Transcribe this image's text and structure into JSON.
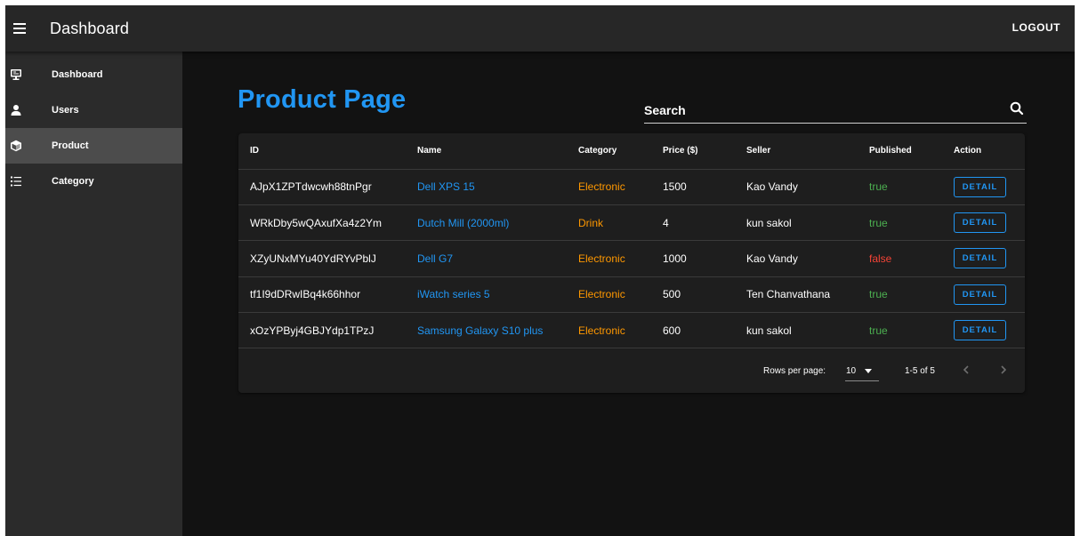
{
  "appbar": {
    "title": "Dashboard",
    "logout_label": "LOGOUT"
  },
  "sidebar": {
    "items": [
      {
        "label": "Dashboard",
        "icon": "monitor-icon"
      },
      {
        "label": "Users",
        "icon": "user-icon"
      },
      {
        "label": "Product",
        "icon": "cube-icon",
        "active": true
      },
      {
        "label": "Category",
        "icon": "list-icon"
      }
    ]
  },
  "main": {
    "title": "Product Page",
    "search": {
      "placeholder": "Search",
      "value": ""
    }
  },
  "table": {
    "headers": [
      "ID",
      "Name",
      "Category",
      "Price ($)",
      "Seller",
      "Published",
      "Action"
    ],
    "rows": [
      {
        "id": "AJpX1ZPTdwcwh88tnPgr",
        "name": "Dell XPS 15",
        "category": "Electronic",
        "price": "1500",
        "seller": "Kao Vandy",
        "published": "true",
        "action": "DETAIL"
      },
      {
        "id": "WRkDby5wQAxufXa4z2Ym",
        "name": "Dutch Mill (2000ml)",
        "category": "Drink",
        "price": "4",
        "seller": "kun sakol",
        "published": "true",
        "action": "DETAIL"
      },
      {
        "id": "XZyUNxMYu40YdRYvPblJ",
        "name": "Dell G7",
        "category": "Electronic",
        "price": "1000",
        "seller": "Kao Vandy",
        "published": "false",
        "action": "DETAIL"
      },
      {
        "id": "tf1I9dDRwIBq4k66hhor",
        "name": "iWatch series 5",
        "category": "Electronic",
        "price": "500",
        "seller": "Ten Chanvathana",
        "published": "true",
        "action": "DETAIL"
      },
      {
        "id": "xOzYPByj4GBJYdp1TPzJ",
        "name": "Samsung Galaxy S10 plus",
        "category": "Electronic",
        "price": "600",
        "seller": "kun sakol",
        "published": "true",
        "action": "DETAIL"
      }
    ]
  },
  "pagination": {
    "rows_per_page_label": "Rows per page:",
    "rows_per_page": "10",
    "range": "1-5 of 5"
  },
  "colors": {
    "primary": "#2196f3",
    "category": "#ff9800",
    "published_true": "#4caf50",
    "published_false": "#f44336"
  }
}
